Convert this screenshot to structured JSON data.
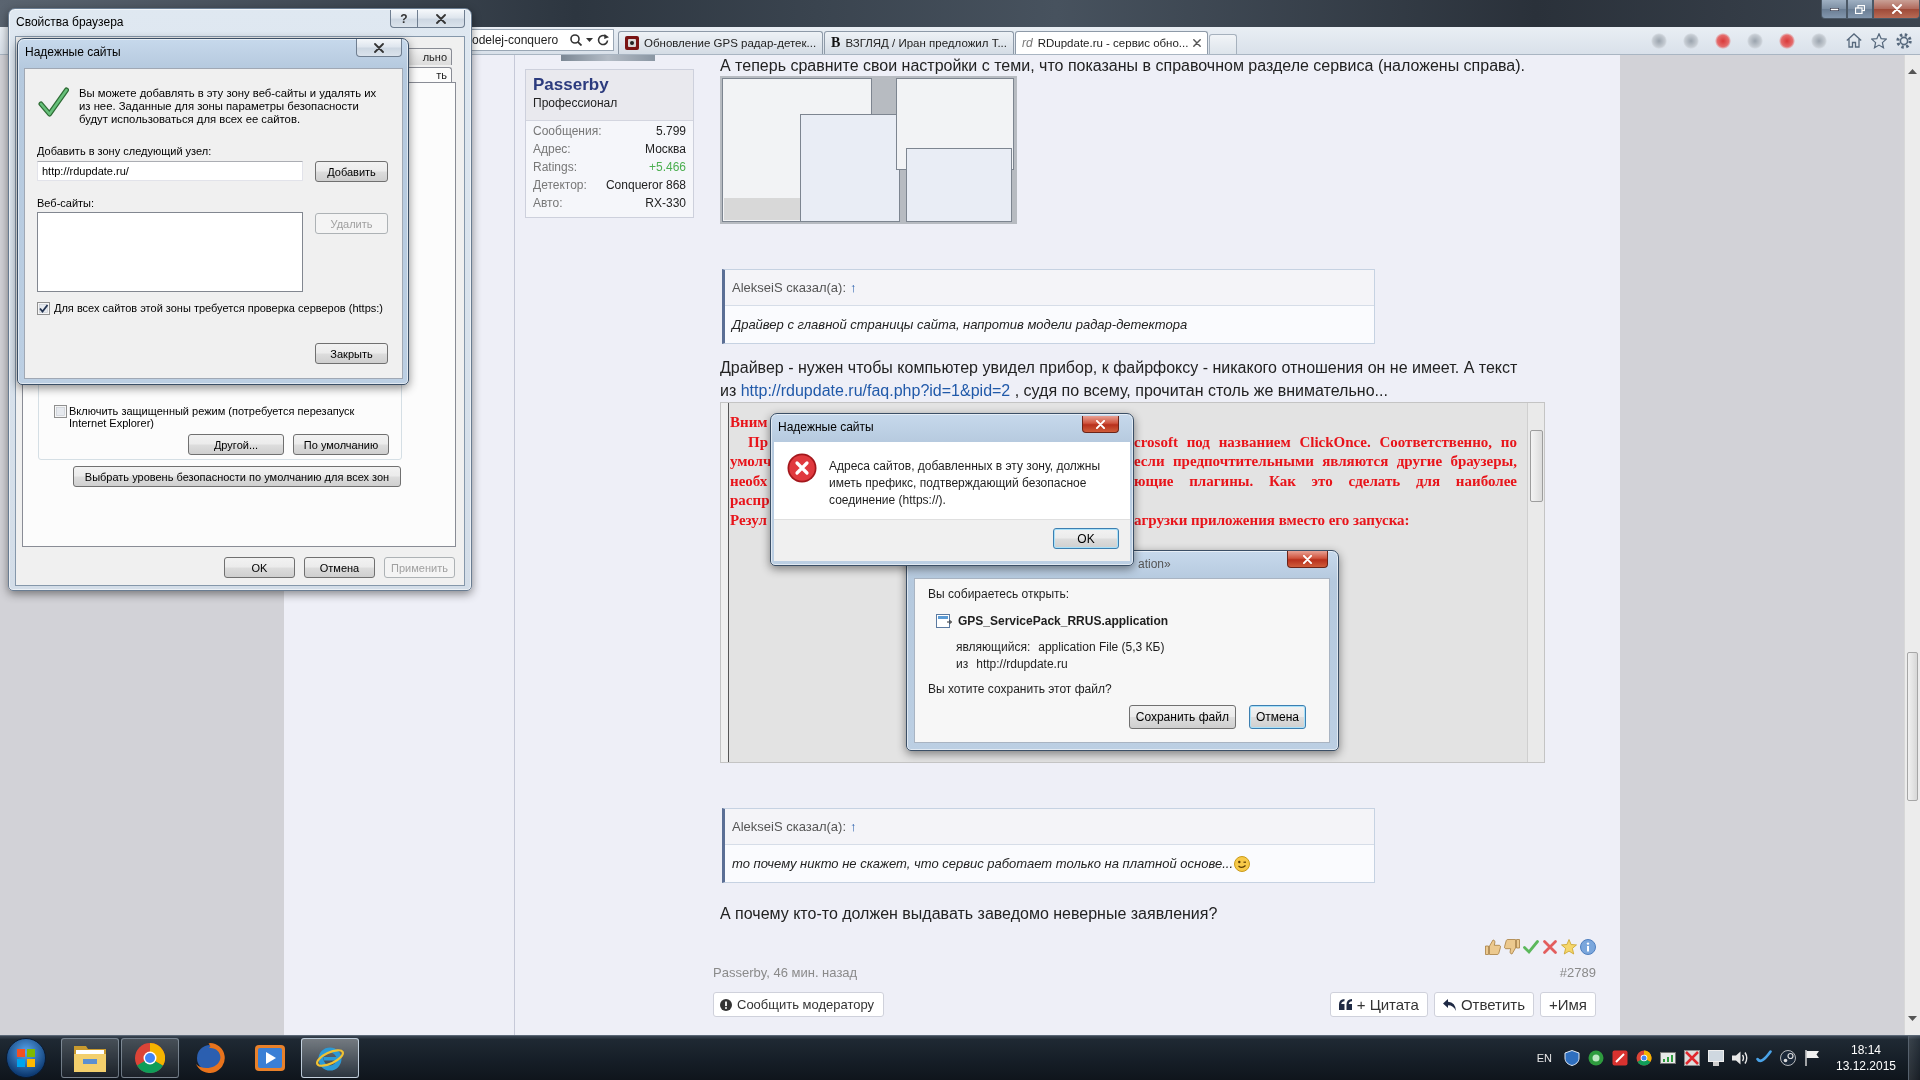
{
  "browser": {
    "address_fragment": "odelej-conquero",
    "tabs": [
      {
        "title": "Обновление GPS радар-детек...",
        "favicon": {
          "kind": "image"
        },
        "selected": false
      },
      {
        "title": "ВЗГЛЯД / Иран предложил Т...",
        "favicon": {
          "kind": "letter",
          "text": "В"
        },
        "selected": false
      },
      {
        "title": "RDupdate.ru - сервис обно...",
        "favicon": {
          "kind": "letter",
          "text": "rd"
        },
        "selected": true
      }
    ]
  },
  "post": {
    "author": {
      "name": "Passerby",
      "rank": "Профессионал",
      "stats": [
        {
          "label": "Сообщения:",
          "value": "5.799",
          "kind": "plain"
        },
        {
          "label": "Адрес:",
          "value": "Москва",
          "kind": "plain"
        },
        {
          "label": "Ratings:",
          "value": "+5.466",
          "kind": "rating"
        },
        {
          "label": "Детектор:",
          "value": "Conqueror 868",
          "kind": "plain"
        },
        {
          "label": "Авто:",
          "value": "RX-330",
          "kind": "plain"
        }
      ]
    },
    "blocks": [
      {
        "kind": "text",
        "parts": [
          {
            "kind": "text",
            "text": "А теперь сравните свои настройки с теми, что показаны в справочном разделе сервиса (наложены справа)."
          }
        ]
      },
      {
        "kind": "thumbnail"
      },
      {
        "kind": "quote",
        "author": "AlekseiS сказал(а):",
        "jump": "↑",
        "text": "Драйвер с главной страницы сайта, напротив модели радар-детектора"
      },
      {
        "kind": "text",
        "parts": [
          {
            "kind": "text",
            "text": "Драйвер - нужен чтобы компьютер увидел прибор, к файрфоксу - никакого отношения он не имеет. А текст из "
          },
          {
            "kind": "link",
            "text": "http://rdupdate.ru/faq.php?id=1&pid=2"
          },
          {
            "kind": "text",
            "text": " , судя по всему, прочитан столь же внимательно..."
          }
        ]
      },
      {
        "kind": "screenshot",
        "lines": [
          {
            "left": "Вним",
            "indent": false
          },
          {
            "left": "Пр",
            "indent": true,
            "right": "crosoft под названием ClickOnce. Соответственно, по",
            "justified": true
          },
          {
            "left": "умолч",
            "indent": false,
            "right": "если предпочтительными являются другие браузеры,",
            "justified": true
          },
          {
            "left": "необх",
            "indent": false,
            "right": "ющие плагины. Как это сделать для наиболее",
            "justified": true
          },
          {
            "left": "распр",
            "indent": false
          },
          {
            "left": "Резул",
            "indent": false,
            "right": "агрузки приложения вместо его запуска:",
            "justified": false
          }
        ],
        "error_dialog": {
          "title": "Надежные сайты",
          "message": "Адреса сайтов, добавленных в эту зону, должны иметь префикс, подтверждающий безопасное соединение (https://).",
          "button": {
            "label": "OK",
            "default": true
          }
        },
        "save_dialog": {
          "title_fragment": "ation»",
          "prompt": "Вы собираетесь открыть:",
          "file_name": "GPS_ServicePack_RRUS.application",
          "details": [
            {
              "label": "являющийся:",
              "value": "application File (5,3 КБ)"
            },
            {
              "label": "из",
              "value": "http://rdupdate.ru"
            }
          ],
          "question": "Вы хотите сохранить этот файл?",
          "buttons": [
            {
              "label": "Сохранить файл",
              "default": false
            },
            {
              "label": "Отмена",
              "default": true
            }
          ]
        }
      },
      {
        "kind": "quote",
        "author": "AlekseiS сказал(а):",
        "jump": "↑",
        "text": "то почему никто не скажет, что сервис работает только на платной основе...",
        "smiley": true
      },
      {
        "kind": "text",
        "parts": [
          {
            "kind": "text",
            "text": "А почему кто-то должен выдавать заведомо неверные заявления?"
          }
        ]
      }
    ],
    "signature": "Passerby, 46 мин. назад",
    "number": "#2789",
    "report_button": "Сообщить модератору",
    "actions": [
      {
        "kind": "quote",
        "label": "+ Цитата"
      },
      {
        "kind": "reply",
        "label": "Ответить"
      },
      {
        "kind": "plain",
        "label": "+Имя"
      }
    ]
  },
  "options_dialog": {
    "title": "Свойства браузера",
    "help": "?",
    "tab_fragments": [
      {
        "label": "льно",
        "selected": false
      },
      {
        "label": "ть",
        "selected": true
      }
    ],
    "protected_mode": {
      "label": "Включить защищенный режим (потребуется перезапуск Internet Explorer)",
      "checked": false
    },
    "level_buttons": [
      "Другой...",
      "По умолчанию"
    ],
    "reset_button": "Выбрать уровень безопасности по умолчанию для всех зон",
    "footer_buttons": [
      {
        "label": "OK",
        "disabled": false
      },
      {
        "label": "Отмена",
        "disabled": false
      },
      {
        "label": "Применить",
        "disabled": true
      }
    ]
  },
  "trusted_sites_dialog": {
    "title": "Надежные сайты",
    "info": "Вы можете добавлять в эту зону веб-сайты и удалять их из нее. Заданные для зоны параметры безопасности будут использоваться для всех ее сайтов.",
    "add_label": "Добавить в зону следующий узел:",
    "add_value": "http://rdupdate.ru/",
    "add_button": {
      "label": "Добавить",
      "disabled": false
    },
    "list_label": "Веб-сайты:",
    "remove_button": {
      "label": "Удалить",
      "disabled": true
    },
    "require_https": {
      "label": "Для всех сайтов этой зоны требуется проверка серверов (https:)",
      "checked": true
    },
    "close_button": "Закрыть"
  },
  "taskbar": {
    "apps": [
      {
        "kind": "folder",
        "running": true,
        "selected": false
      },
      {
        "kind": "tricolor",
        "running": true,
        "selected": false
      },
      {
        "kind": "globe",
        "running": false,
        "selected": false
      },
      {
        "kind": "player",
        "running": false,
        "selected": false
      },
      {
        "kind": "swirl",
        "running": true,
        "selected": true
      }
    ],
    "language": "EN",
    "time": "18:14",
    "date": "13.12.2015"
  }
}
